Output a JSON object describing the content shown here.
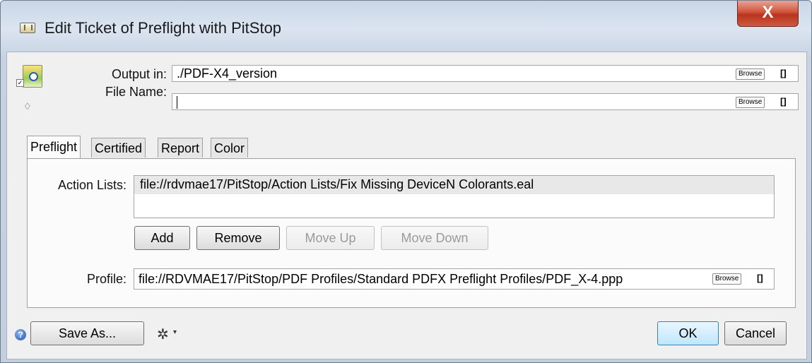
{
  "window": {
    "title": "Edit Ticket of Preflight with PitStop",
    "close_label": "X"
  },
  "header": {
    "output_label": "Output in:",
    "output_value": "./PDF-X4_version",
    "filename_label": "File Name:",
    "filename_value": "",
    "browse_label": "Browse",
    "bracket_label": "[]"
  },
  "tabs": [
    {
      "label": "Preflight",
      "active": true
    },
    {
      "label": "Certified",
      "active": false
    },
    {
      "label": "Report",
      "active": false
    },
    {
      "label": "Color",
      "active": false
    }
  ],
  "preflight": {
    "action_lists_label": "Action Lists:",
    "action_lists": [
      "file://rdvmae17/PitStop/Action Lists/Fix Missing DeviceN Colorants.eal"
    ],
    "add_label": "Add",
    "remove_label": "Remove",
    "move_up_label": "Move Up",
    "move_down_label": "Move Down",
    "profile_label": "Profile:",
    "profile_value": "file://RDVMAE17/PitStop/PDF Profiles/Standard PDFX Preflight Profiles/PDF_X-4.ppp",
    "browse_label": "Browse",
    "bracket_label": "[]"
  },
  "footer": {
    "help_glyph": "?",
    "save_as_label": "Save As...",
    "gear_glyph": "✲",
    "caret_glyph": "▾",
    "ok_label": "OK",
    "cancel_label": "Cancel"
  },
  "colors": {
    "titlebar": "#c9d6e6",
    "close_button": "#c7462e",
    "default_button": "#bee6fd"
  }
}
